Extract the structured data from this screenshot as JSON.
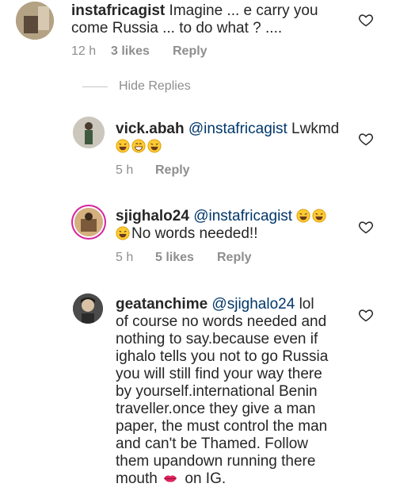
{
  "comments": [
    {
      "username": "instafricagist",
      "line1": " Imagine ... e carry you",
      "line2": "come Russia ... to do what ? ....",
      "time": "12 h",
      "likes": "3 likes",
      "reply": "Reply"
    },
    {
      "username": "vick.abah",
      "mention": " @instafricagist",
      "text": " Lwkmd",
      "time": "5 h",
      "reply": "Reply"
    },
    {
      "username": "sjighalo24",
      "mention": " @instafricagist",
      "text": "No words needed!!",
      "time": "5 h",
      "likes": "5 likes",
      "reply": "Reply"
    },
    {
      "username": "geatanchime",
      "mention": " @sjighalo24",
      "first": " lol",
      "lines": [
        "of course no words needed and",
        "nothing to say.because even if",
        "ighalo tells you not to go Russia",
        "you will still find your way there",
        "by yourself.international Benin",
        "traveller.once they give a man",
        "paper, the must control the man",
        "and can't be Thamed. Follow",
        "them upandown running there"
      ],
      "last_a": "mouth ",
      "last_b": " on IG."
    }
  ],
  "hide_replies": "Hide Replies",
  "icons": {
    "heart": "heart-outline-icon",
    "laugh": "laughing-emoji-icon",
    "grin": "grinning-emoji-icon",
    "lips": "lips-emoji-icon"
  },
  "colors": {
    "text": "#262626",
    "meta": "#8e8e8e",
    "mention": "#00376b"
  }
}
